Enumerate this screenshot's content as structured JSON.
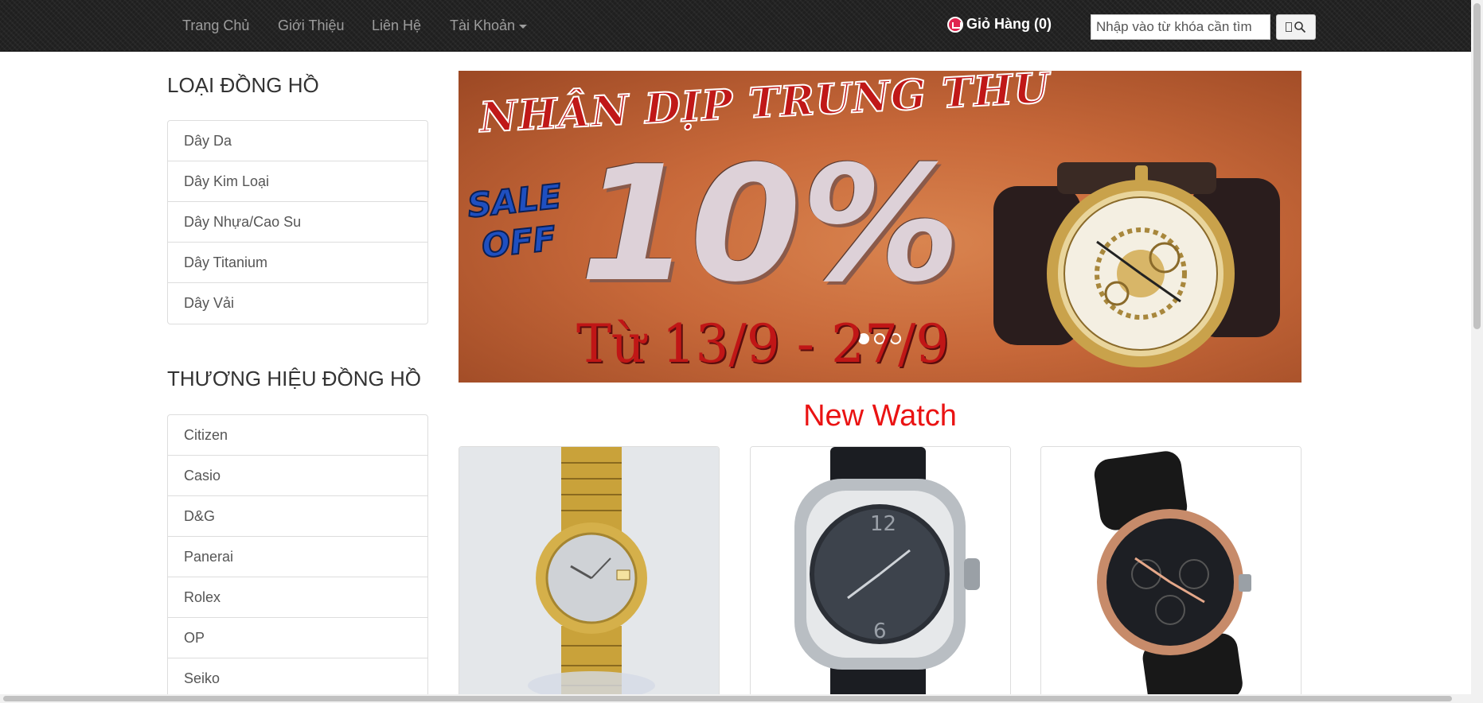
{
  "nav": {
    "items": [
      "Trang Chủ",
      "Giới Thiệu",
      "Liên Hệ",
      "Tài Khoản"
    ],
    "cart_label": "Giỏ Hàng (0)",
    "search_placeholder": "Nhập vào từ khóa cần tìm"
  },
  "sidebar": {
    "categories_title": "LOẠI ĐỒNG HỒ",
    "categories": [
      "Dây Da",
      "Dây Kim Loại",
      "Dây Nhựa/Cao Su",
      "Dây Titanium",
      "Dây Vải"
    ],
    "brands_title": "THƯƠNG HIỆU ĐỒNG HỒ",
    "brands": [
      "Citizen",
      "Casio",
      "D&G",
      "Panerai",
      "Rolex",
      "OP",
      "Seiko"
    ]
  },
  "banner": {
    "headline": "NHÂN DỊP TRUNG THU",
    "sale_line1": "SALE",
    "sale_line2": "OFF",
    "discount": "10%",
    "dates": "Từ 13/9 - 27/9",
    "slide_count": 3,
    "active_slide": 1
  },
  "section_title": "New Watch",
  "colors": {
    "navbar": "#1f1f1f",
    "nav_text": "#9d9d9d",
    "section_title": "#ea1313",
    "banner_bg": "#c8693a"
  }
}
